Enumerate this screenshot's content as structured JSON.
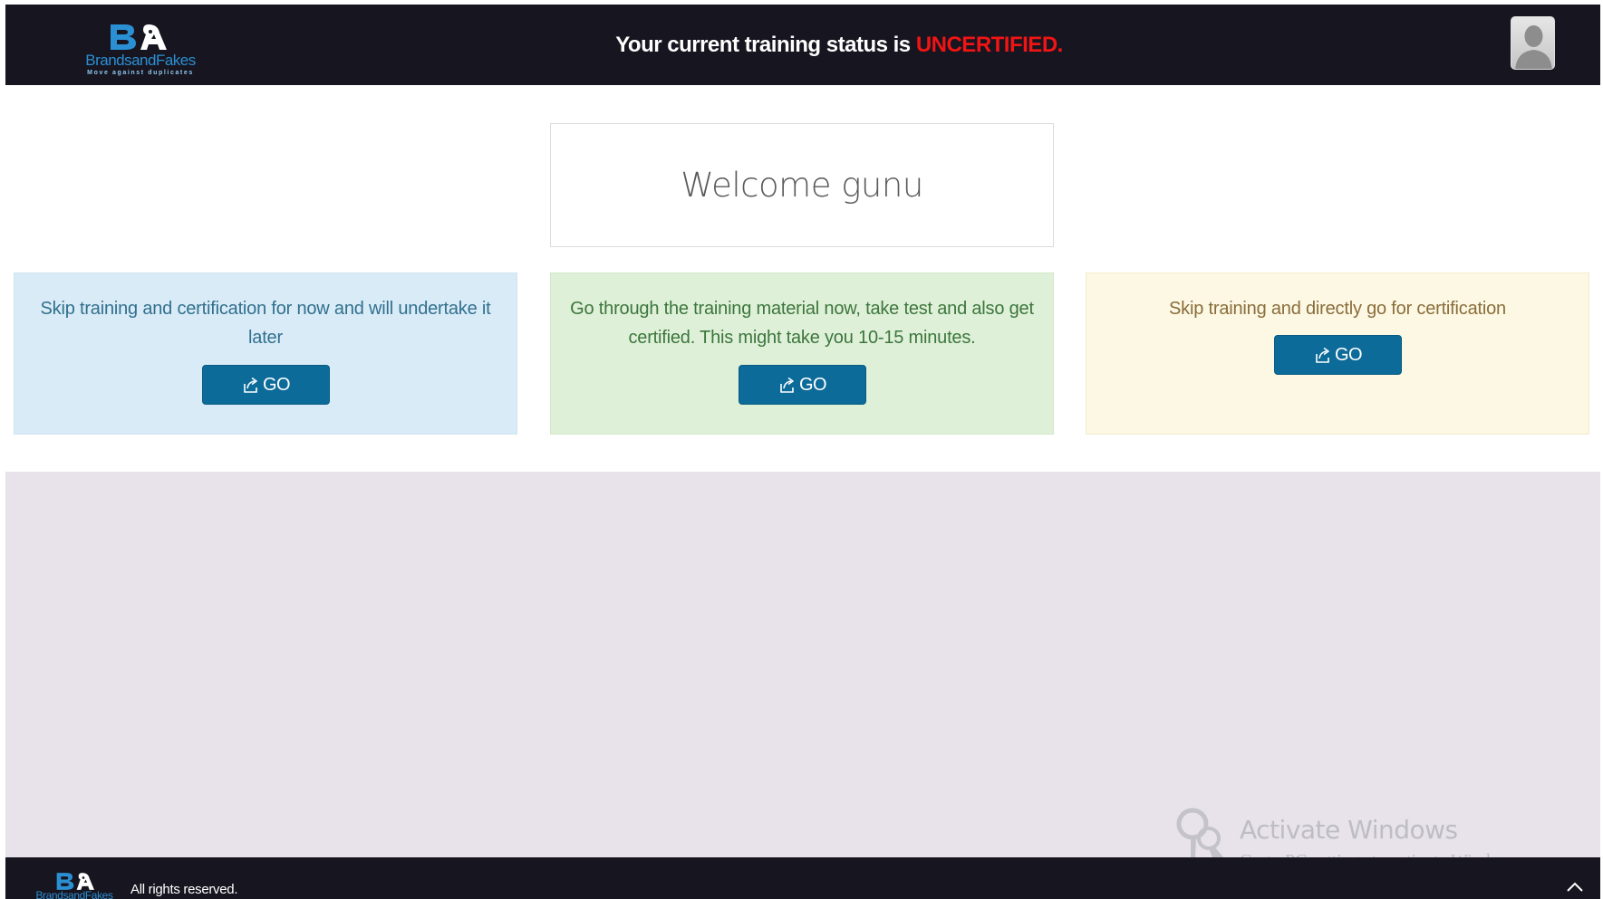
{
  "header": {
    "logo": {
      "monogram": "B&a",
      "brand_name": "BrandsandFakes",
      "tagline": "Move against duplicates"
    },
    "status": {
      "prefix": "Your current training status is ",
      "value": "UNCERTIFIED."
    },
    "avatar_icon": "user-silhouette-icon"
  },
  "welcome": {
    "text": "Welcome gunu"
  },
  "options": [
    {
      "description": "Skip training and certification for now and will undertake it later",
      "button_label": "GO",
      "button_icon": "share-icon",
      "bg_color": "#d9ebf6",
      "text_color": "#31708f"
    },
    {
      "description": "Go through the training material now, take test and also get certified. This might take you 10-15 minutes.",
      "button_label": "GO",
      "button_icon": "share-icon",
      "bg_color": "#dff0d8",
      "text_color": "#3c763d"
    },
    {
      "description": "Skip training and directly go for certification",
      "button_label": "GO",
      "button_icon": "share-icon",
      "bg_color": "#fcf8e3",
      "text_color": "#8a6d3b"
    }
  ],
  "watermark": {
    "title": "Activate Windows",
    "subtitle": "Go to PC settings to activate Windows.",
    "icon": "key-icon"
  },
  "footer": {
    "logo_name": "BrandsandFakes",
    "text": "All rights reserved.",
    "scroll_icon": "chevron-up-icon"
  },
  "colors": {
    "header_bg": "#17151f",
    "status_alert": "#f01515",
    "button_bg": "#0c6b99",
    "band_bg": "#e8e3ea"
  }
}
